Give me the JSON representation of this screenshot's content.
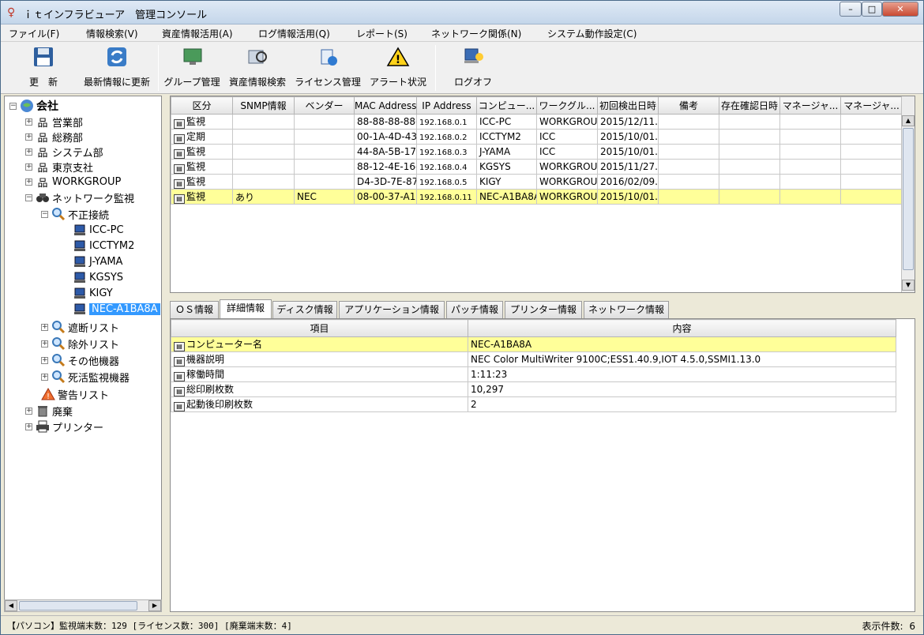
{
  "window": {
    "title": "ｉｔインフラビューア　管理コンソール",
    "buttons": {
      "minimize": "–",
      "maximize": "□",
      "close": "✕"
    }
  },
  "menu": [
    "ファイル(F)",
    "情報検索(V)",
    "資産情報活用(A)",
    "ログ情報活用(Q)",
    "レポート(S)",
    "ネットワーク関係(N)",
    "システム動作設定(C)"
  ],
  "toolbar": [
    {
      "label": "更　新",
      "icon": "floppy-icon"
    },
    {
      "label": "最新情報に更新",
      "icon": "refresh-icon"
    },
    {
      "label": "グループ管理",
      "icon": "monitor-icon"
    },
    {
      "label": "資産情報検索",
      "icon": "asset-search-icon"
    },
    {
      "label": "ライセンス管理",
      "icon": "license-icon"
    },
    {
      "label": "アラート状況",
      "icon": "alert-icon"
    },
    {
      "label": "ログオフ",
      "icon": "logoff-icon"
    }
  ],
  "tree": {
    "root": "会社",
    "groups": [
      "営業部",
      "総務部",
      "システム部",
      "東京支社",
      "WORKGROUP"
    ],
    "network": "ネットワーク監視",
    "unauthorized": "不正接続",
    "hosts": [
      "ICC-PC",
      "ICCTYM2",
      "J-YAMA",
      "KGSYS",
      "KIGY",
      "NEC-A1BA8A"
    ],
    "sub_lists": [
      "遮断リスト",
      "除外リスト",
      "その他機器",
      "死活監視機器"
    ],
    "warning": "警告リスト",
    "disposal": "廃棄",
    "printer": "プリンター"
  },
  "device_table": {
    "columns": [
      "区分",
      "SNMP情報",
      "ベンダー",
      "MAC Address",
      "IP Address",
      "コンピュー...",
      "ワークグル...",
      "初回検出日時",
      "備考",
      "存在確認日時",
      "マネージャ...",
      "マネージャ..."
    ],
    "rows": [
      [
        "監視",
        "",
        "",
        "88-88-88-88-8",
        "192.168.0.1",
        "ICC-PC",
        "WORKGROU",
        "2015/12/11..."
      ],
      [
        "定期",
        "",
        "",
        "00-1A-4D-43-",
        "192.168.0.2",
        "ICCTYM2",
        "ICC",
        "2015/10/01..."
      ],
      [
        "監視",
        "",
        "",
        "44-8A-5B-17-",
        "192.168.0.3",
        "J-YAMA",
        "ICC",
        "2015/10/01..."
      ],
      [
        "監視",
        "",
        "",
        "88-12-4E-16-",
        "192.168.0.4",
        "KGSYS",
        "WORKGROU",
        "2015/11/27..."
      ],
      [
        "監視",
        "",
        "",
        "D4-3D-7E-87-",
        "192.168.0.5",
        "KIGY",
        "WORKGROU",
        "2016/02/09..."
      ],
      [
        "監視",
        "あり",
        "NEC",
        "08-00-37-A1-I",
        "192.168.0.11",
        "NEC-A1BA8A",
        "WORKGROU",
        "2015/10/01..."
      ]
    ]
  },
  "tabs": [
    "ＯＳ情報",
    "詳細情報",
    "ディスク情報",
    "アプリケーション情報",
    "パッチ情報",
    "プリンター情報",
    "ネットワーク情報"
  ],
  "detail_table": {
    "columns": [
      "項目",
      "内容"
    ],
    "rows": [
      [
        "コンピューター名",
        "NEC-A1BA8A"
      ],
      [
        "機器説明",
        "NEC Color MultiWriter 9100C;ESS1.40.9,IOT 4.5.0,SSMI1.13.0"
      ],
      [
        "稼働時間",
        " 1:11:23"
      ],
      [
        "総印刷枚数",
        "10,297"
      ],
      [
        "起動後印刷枚数",
        "2"
      ]
    ]
  },
  "status": {
    "left": "【パソコン】監視端末数：129 [ライセンス数：300] [廃棄端末数：4]",
    "right_label": "表示件数:",
    "right_value": "6"
  }
}
